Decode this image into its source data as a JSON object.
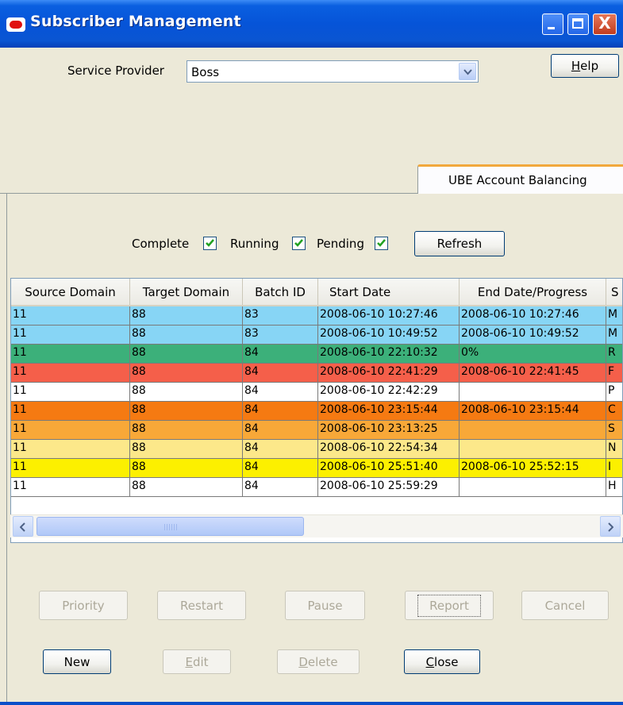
{
  "window": {
    "title": "Subscriber Management",
    "close_glyph": "X"
  },
  "header": {
    "service_provider_label": "Service Provider",
    "service_provider_value": "Boss",
    "help_label": "Help"
  },
  "tabs": [
    {
      "label": "UBE Account Balancing",
      "active": true
    }
  ],
  "filters": {
    "complete": {
      "label": "Complete",
      "checked": true
    },
    "running": {
      "label": "Running",
      "checked": true
    },
    "pending": {
      "label": "Pending",
      "checked": true
    },
    "refresh_label": "Refresh"
  },
  "table": {
    "columns": [
      "Source Domain",
      "Target Domain",
      "Batch ID",
      "Start Date",
      "End Date/Progress",
      "S"
    ],
    "rows": [
      {
        "cells": [
          "11",
          "88",
          "83",
          "2008-06-10 10:27:46",
          "2008-06-10 10:27:46",
          "M"
        ],
        "color": "#87d5f5"
      },
      {
        "cells": [
          "11",
          "88",
          "83",
          "2008-06-10 10:49:52",
          "2008-06-10 10:49:52",
          "M"
        ],
        "color": "#87d5f5"
      },
      {
        "cells": [
          "11",
          "88",
          "84",
          "2008-06-10 22:10:32",
          "0%",
          "R"
        ],
        "color": "#3cb07a"
      },
      {
        "cells": [
          "11",
          "88",
          "84",
          "2008-06-10 22:41:29",
          "2008-06-10 22:41:45",
          "F"
        ],
        "color": "#f55f4a"
      },
      {
        "cells": [
          "11",
          "88",
          "84",
          "2008-06-10 22:42:29",
          "",
          "P"
        ],
        "color": "#ffffff"
      },
      {
        "cells": [
          "11",
          "88",
          "84",
          "2008-06-10 23:15:44",
          "2008-06-10 23:15:44",
          "C"
        ],
        "color": "#f57a12"
      },
      {
        "cells": [
          "11",
          "88",
          "84",
          "2008-06-10 23:13:25",
          "",
          "S"
        ],
        "color": "#f8a838"
      },
      {
        "cells": [
          "11",
          "88",
          "84",
          "2008-06-10 22:54:34",
          "",
          "N"
        ],
        "color": "#fce88a"
      },
      {
        "cells": [
          "11",
          "88",
          "84",
          "2008-06-10 25:51:40",
          "2008-06-10 25:52:15",
          "I"
        ],
        "color": "#fcf000"
      },
      {
        "cells": [
          "11",
          "88",
          "84",
          "2008-06-10 25:59:29",
          "",
          "H"
        ],
        "color": "#ffffff"
      }
    ]
  },
  "actions": {
    "priority": "Priority",
    "restart": "Restart",
    "pause": "Pause",
    "report": "Report",
    "cancel": "Cancel",
    "new": "New",
    "edit": {
      "mnemonic": "E",
      "rest": "dit"
    },
    "delete": {
      "mnemonic": "D",
      "rest": "elete"
    },
    "close": {
      "mnemonic": "C",
      "rest": "lose"
    }
  },
  "icons": {
    "app": "oracle-logo-icon",
    "minimize": "minimize-icon",
    "maximize": "maximize-icon",
    "close": "close-icon",
    "dropdown": "chevron-down-icon",
    "check": "checkmark-icon",
    "scroll_left": "arrow-left-icon",
    "scroll_right": "arrow-right-icon"
  },
  "colors": {
    "titlebar": "#0654d8",
    "tab_accent": "#f1a83c",
    "checkbox_tick": "#21a121"
  }
}
